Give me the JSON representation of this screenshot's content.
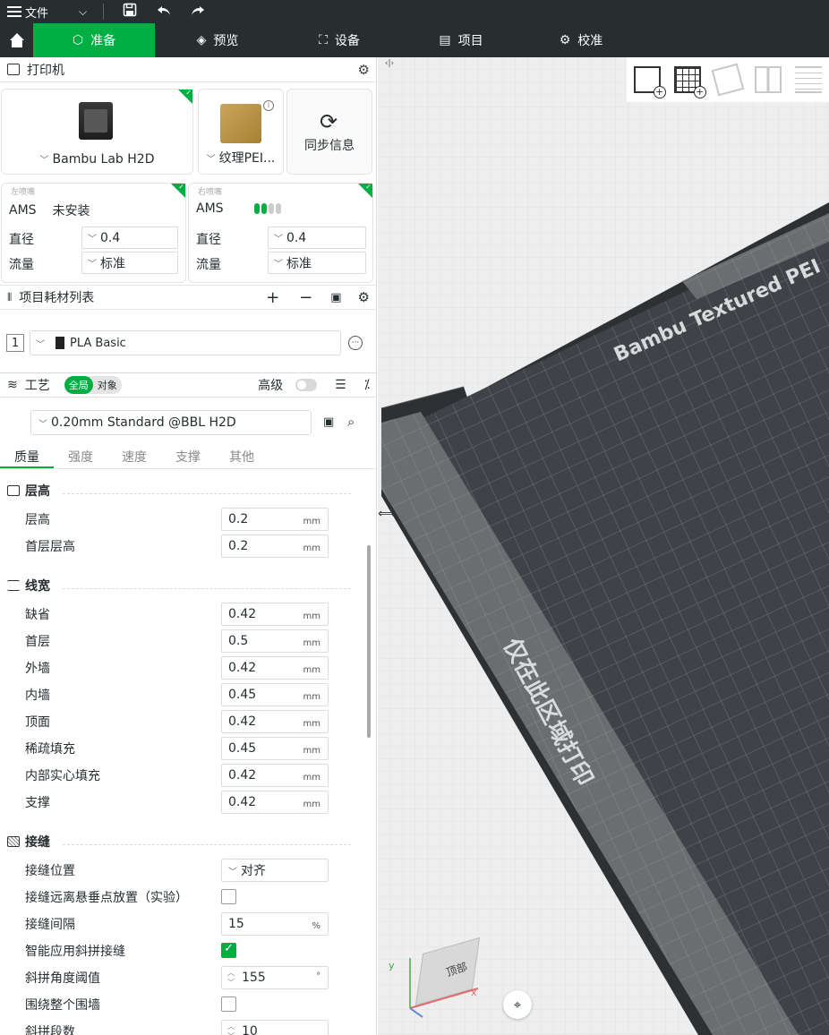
{
  "titlebar": {
    "file_label": "文件"
  },
  "nav": {
    "tabs": [
      {
        "label": "准备",
        "icon": "cube-icon"
      },
      {
        "label": "预览",
        "icon": "layers-icon"
      },
      {
        "label": "设备",
        "icon": "device-icon"
      },
      {
        "label": "项目",
        "icon": "project-icon"
      },
      {
        "label": "校准",
        "icon": "calibrate-icon"
      }
    ]
  },
  "printer": {
    "title": "打印机",
    "model": "Bambu Lab H2D",
    "plate": "纹理PEI...",
    "sync_label": "同步信息"
  },
  "nozzles": {
    "left": {
      "title": "左喷嘴",
      "ams_label": "AMS",
      "ams_value": "未安装",
      "diameter_label": "直径",
      "diameter": "0.4",
      "flow_label": "流量",
      "flow": "标准"
    },
    "right": {
      "title": "右喷嘴",
      "ams_label": "AMS",
      "diameter_label": "直径",
      "diameter": "0.4",
      "flow_label": "流量",
      "flow": "标准"
    }
  },
  "filaments": {
    "title": "项目耗材列表",
    "items": [
      {
        "index": "1",
        "name": "PLA Basic",
        "color": "#222222"
      }
    ]
  },
  "process": {
    "title": "工艺",
    "toggle_global": "全局",
    "toggle_object": "对象",
    "advanced_label": "高级",
    "preset": "0.20mm Standard @BBL H2D",
    "subtabs": [
      "质量",
      "强度",
      "速度",
      "支撑",
      "其他"
    ]
  },
  "params": {
    "layer_height": {
      "title": "层高",
      "rows": [
        {
          "label": "层高",
          "value": "0.2",
          "unit": "mm"
        },
        {
          "label": "首层层高",
          "value": "0.2",
          "unit": "mm"
        }
      ]
    },
    "line_width": {
      "title": "线宽",
      "rows": [
        {
          "label": "缺省",
          "value": "0.42",
          "unit": "mm"
        },
        {
          "label": "首层",
          "value": "0.5",
          "unit": "mm"
        },
        {
          "label": "外墙",
          "value": "0.42",
          "unit": "mm"
        },
        {
          "label": "内墙",
          "value": "0.45",
          "unit": "mm"
        },
        {
          "label": "顶面",
          "value": "0.42",
          "unit": "mm"
        },
        {
          "label": "稀疏填充",
          "value": "0.45",
          "unit": "mm"
        },
        {
          "label": "内部实心填充",
          "value": "0.42",
          "unit": "mm"
        },
        {
          "label": "支撑",
          "value": "0.42",
          "unit": "mm"
        }
      ]
    },
    "seam": {
      "title": "接缝",
      "position_label": "接缝位置",
      "position_value": "对齐",
      "away_label": "接缝远离悬垂点放置（实验）",
      "gap_label": "接缝间隔",
      "gap_value": "15",
      "gap_unit": "%",
      "scarf_label": "智能应用斜拼接缝",
      "angle_label": "斜拼角度阈值",
      "angle_value": "155",
      "angle_unit": "°",
      "wall_label": "围绕整个围墙",
      "steps_label": "斜拼段数",
      "steps_value": "10"
    }
  },
  "viewport": {
    "plate_text_1": "Bambu Textured PEI",
    "plate_text_2": "仅在此区域打印",
    "cube_label": "顶部",
    "axis_x": "x",
    "axis_y": "y"
  }
}
